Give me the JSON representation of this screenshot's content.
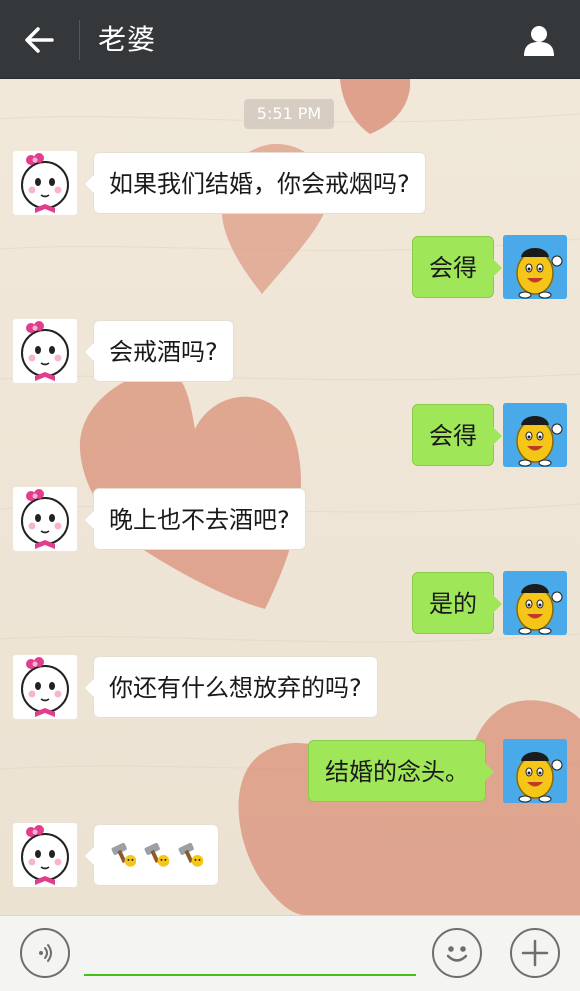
{
  "header": {
    "title": "老婆",
    "back_icon": "arrow-left-icon",
    "profile_icon": "person-icon",
    "background_color": "#35383b"
  },
  "chat": {
    "timestamp": "5:51 PM",
    "messages": [
      {
        "from": "her",
        "text": "如果我们结婚，你会戒烟吗?"
      },
      {
        "from": "me",
        "text": "会得"
      },
      {
        "from": "her",
        "text": "会戒酒吗?"
      },
      {
        "from": "me",
        "text": "会得"
      },
      {
        "from": "her",
        "text": "晚上也不去酒吧?"
      },
      {
        "from": "me",
        "text": "是的"
      },
      {
        "from": "her",
        "text": "你还有什么想放弃的吗?"
      },
      {
        "from": "me",
        "text": "结婚的念头。"
      },
      {
        "from": "her",
        "text": "",
        "emoji": [
          "hammer-emoji",
          "hammer-emoji",
          "hammer-emoji"
        ]
      }
    ],
    "colors": {
      "incoming_bubble": "#ffffff",
      "outgoing_bubble": "#9fe659",
      "background": "#efe6d8",
      "heart": "#d98a72"
    }
  },
  "input_bar": {
    "placeholder": "",
    "voice_icon": "voice-icon",
    "emoji_icon": "smiley-icon",
    "plus_icon": "plus-icon",
    "accent_color": "#45c01a"
  }
}
